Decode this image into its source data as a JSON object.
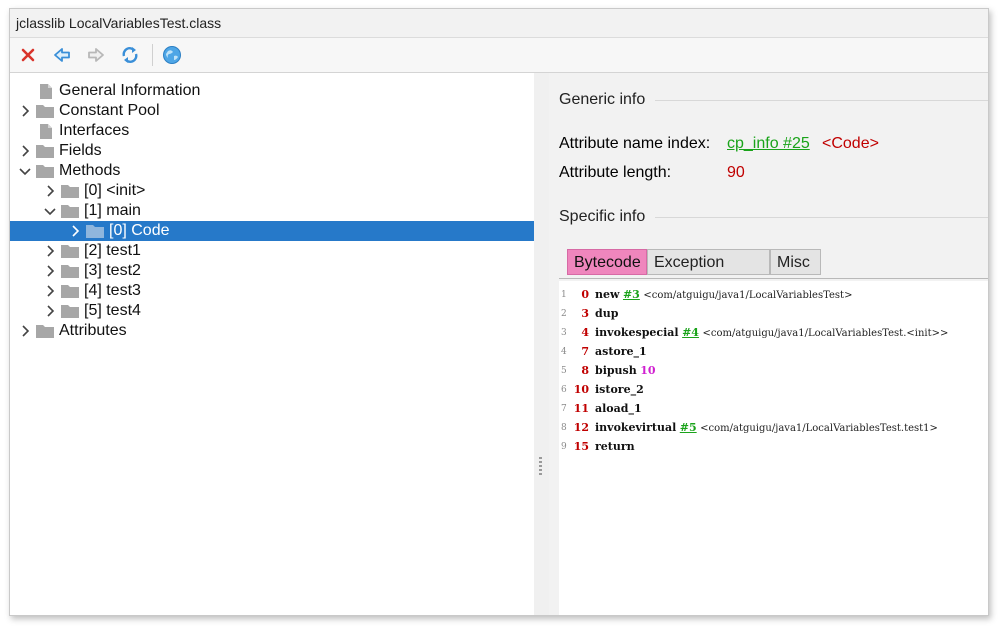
{
  "window": {
    "title": "jclasslib LocalVariablesTest.class"
  },
  "toolbar": {
    "buttons": [
      {
        "name": "close-icon",
        "color": "#d9342b"
      },
      {
        "name": "back-arrow-icon",
        "color": "#3a8fd8"
      },
      {
        "name": "forward-arrow-icon",
        "color": "#b8b8b8"
      },
      {
        "name": "refresh-icon",
        "color": "#3a8fd8"
      },
      {
        "name": "globe-icon",
        "color": "#3a8fd8"
      }
    ]
  },
  "tree": {
    "items": [
      {
        "label": "General Information",
        "level": 0,
        "arrow": "none",
        "icon": "file-icon"
      },
      {
        "label": "Constant Pool",
        "level": 0,
        "arrow": "right",
        "icon": "folder-icon"
      },
      {
        "label": "Interfaces",
        "level": 0,
        "arrow": "none",
        "icon": "file-icon"
      },
      {
        "label": "Fields",
        "level": 0,
        "arrow": "right",
        "icon": "folder-icon"
      },
      {
        "label": "Methods",
        "level": 0,
        "arrow": "down",
        "icon": "folder-icon"
      },
      {
        "label": "[0] <init>",
        "level": 1,
        "arrow": "right",
        "icon": "folder-icon"
      },
      {
        "label": "[1] main",
        "level": 1,
        "arrow": "down",
        "icon": "folder-icon"
      },
      {
        "label": "[0] Code",
        "level": 2,
        "arrow": "right",
        "icon": "folder-icon",
        "selected": true
      },
      {
        "label": "[2] test1",
        "level": 1,
        "arrow": "right",
        "icon": "folder-icon"
      },
      {
        "label": "[3] test2",
        "level": 1,
        "arrow": "right",
        "icon": "folder-icon"
      },
      {
        "label": "[4] test3",
        "level": 1,
        "arrow": "right",
        "icon": "folder-icon"
      },
      {
        "label": "[5] test4",
        "level": 1,
        "arrow": "right",
        "icon": "folder-icon"
      },
      {
        "label": "Attributes",
        "level": 0,
        "arrow": "right",
        "icon": "folder-icon"
      }
    ]
  },
  "generic": {
    "title": "Generic info",
    "name_index_label": "Attribute name index:",
    "name_index_link": "cp_info #25",
    "name_index_value": "<Code>",
    "length_label": "Attribute length:",
    "length_value": "90"
  },
  "specific": {
    "title": "Specific info"
  },
  "tabs": [
    {
      "label": "Bytecode",
      "active": true
    },
    {
      "label": "Exception table",
      "active": false
    },
    {
      "label": "Misc",
      "active": false
    }
  ],
  "bytecode": [
    {
      "line": "1",
      "offset": "0",
      "op": "new",
      "ref": "#3",
      "comment": "<com/atguigu/java1/LocalVariablesTest>",
      "arg": ""
    },
    {
      "line": "2",
      "offset": "3",
      "op": "dup",
      "ref": "",
      "comment": "",
      "arg": ""
    },
    {
      "line": "3",
      "offset": "4",
      "op": "invokespecial",
      "ref": "#4",
      "comment": "<com/atguigu/java1/LocalVariablesTest.<init>>",
      "arg": ""
    },
    {
      "line": "4",
      "offset": "7",
      "op": "astore_1",
      "ref": "",
      "comment": "",
      "arg": ""
    },
    {
      "line": "5",
      "offset": "8",
      "op": "bipush",
      "ref": "",
      "comment": "",
      "arg": "10"
    },
    {
      "line": "6",
      "offset": "10",
      "op": "istore_2",
      "ref": "",
      "comment": "",
      "arg": ""
    },
    {
      "line": "7",
      "offset": "11",
      "op": "aload_1",
      "ref": "",
      "comment": "",
      "arg": ""
    },
    {
      "line": "8",
      "offset": "12",
      "op": "invokevirtual",
      "ref": "#5",
      "comment": "<com/atguigu/java1/LocalVariablesTest.test1>",
      "arg": ""
    },
    {
      "line": "9",
      "offset": "15",
      "op": "return",
      "ref": "",
      "comment": "",
      "arg": ""
    }
  ]
}
